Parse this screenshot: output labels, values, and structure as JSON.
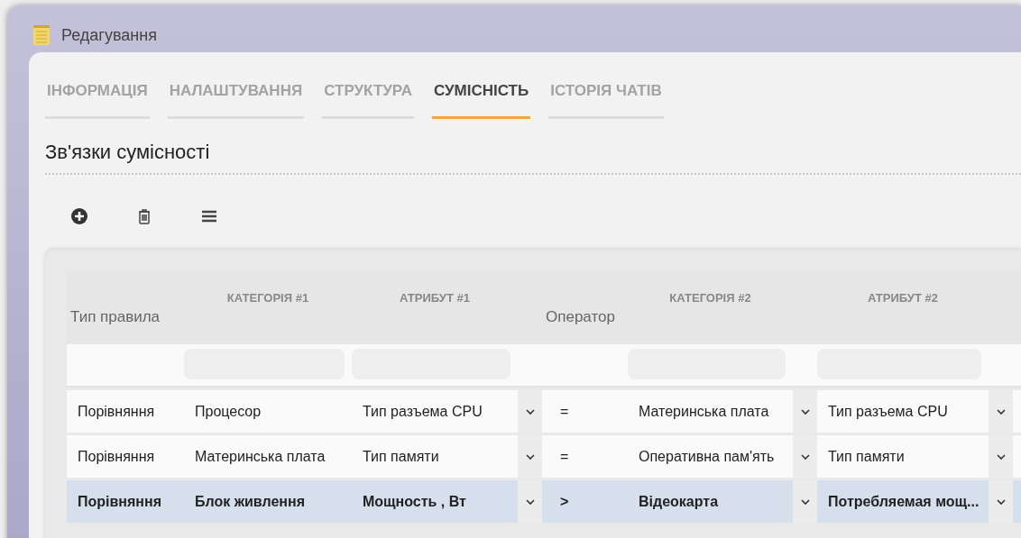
{
  "window": {
    "title": "Редагування"
  },
  "tabs": [
    {
      "label": "ІНФОРМАЦІЯ",
      "selected": false
    },
    {
      "label": "НАЛАШТУВАННЯ",
      "selected": false
    },
    {
      "label": "СТРУКТУРА",
      "selected": false
    },
    {
      "label": "СУМІСНІСТЬ",
      "selected": true
    },
    {
      "label": "ІСТОРІЯ ЧАТІВ",
      "selected": false
    }
  ],
  "section_title": "Зв'язки сумісності",
  "toolbar": [
    {
      "kind": "add"
    },
    {
      "kind": "delete"
    },
    {
      "kind": "menu"
    }
  ],
  "table": {
    "columns": [
      {
        "label": "Тип правила",
        "kind": "plain"
      },
      {
        "label": "КАТЕГОРІЯ #1",
        "kind": "caps"
      },
      {
        "label": "АТРИБУТ #1",
        "kind": "caps"
      },
      {
        "label": "Оператор",
        "kind": "plain"
      },
      {
        "label": "КАТЕГОРІЯ #2",
        "kind": "caps"
      },
      {
        "label": "АТРИБУТ #2",
        "kind": "caps"
      }
    ],
    "filters": [
      {
        "kind": "empty"
      },
      {
        "kind": "field"
      },
      {
        "kind": "field"
      },
      {
        "kind": "empty"
      },
      {
        "kind": "field"
      },
      {
        "kind": "field"
      }
    ],
    "rows": [
      {
        "selected": false,
        "cells": [
          {
            "kind": "text",
            "text": "Порівняння"
          },
          {
            "kind": "text",
            "text": "Процесор"
          },
          {
            "kind": "select",
            "text": "Тип разъема CPU"
          },
          {
            "kind": "text",
            "text": "="
          },
          {
            "kind": "select",
            "text": "Материнська плата"
          },
          {
            "kind": "select",
            "text": "Тип разъема CPU"
          }
        ]
      },
      {
        "selected": false,
        "cells": [
          {
            "kind": "text",
            "text": "Порівняння"
          },
          {
            "kind": "text",
            "text": "Материнська плата"
          },
          {
            "kind": "select",
            "text": "Тип памяти"
          },
          {
            "kind": "text",
            "text": "="
          },
          {
            "kind": "select",
            "text": "Оперативна пам'ять"
          },
          {
            "kind": "select",
            "text": "Тип памяти"
          }
        ]
      },
      {
        "selected": true,
        "cells": [
          {
            "kind": "text",
            "text": "Порівняння"
          },
          {
            "kind": "text",
            "text": "Блок живлення"
          },
          {
            "kind": "select",
            "text": "Мощность , Вт"
          },
          {
            "kind": "text",
            "text": ">"
          },
          {
            "kind": "select",
            "text": "Відеокарта"
          },
          {
            "kind": "select",
            "text": "Потребляемая мощ..."
          }
        ]
      }
    ]
  }
}
